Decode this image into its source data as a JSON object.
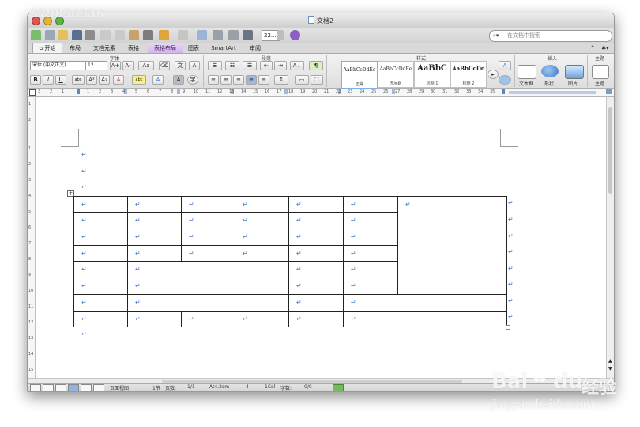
{
  "window": {
    "title": "文档2"
  },
  "toolbar": {
    "zoom": "22..."
  },
  "search": {
    "placeholder": "在文档中搜索"
  },
  "tabs": [
    {
      "label": "开始"
    },
    {
      "label": "布局"
    },
    {
      "label": "文档元素"
    },
    {
      "label": "表格"
    },
    {
      "label": "表格布局"
    },
    {
      "label": "图表"
    },
    {
      "label": "SmartArt"
    },
    {
      "label": "审阅"
    }
  ],
  "ribbon": {
    "font_group_label": "字体",
    "para_group_label": "段落",
    "styles_group_label": "样式",
    "insert_group_label": "插入",
    "theme_group_label": "主题",
    "font_name": "宋体 (中文正文)",
    "font_size": "12",
    "styles": [
      {
        "sample": "AaBbCcDdEe",
        "name": "正常"
      },
      {
        "sample": "AaBbCcDdEe",
        "name": "无间距"
      },
      {
        "sample": "AaBbC",
        "name": "标题 1"
      },
      {
        "sample": "AaBbCcDd",
        "name": "标题 2"
      }
    ],
    "insert": [
      {
        "label": "文本框"
      },
      {
        "label": "形状"
      },
      {
        "label": "图片"
      }
    ],
    "theme_label": "主题"
  },
  "ruler": {
    "marks": [
      "3",
      "2",
      "1",
      "1",
      "2",
      "3",
      "4",
      "5",
      "6",
      "7",
      "8",
      "9",
      "10",
      "11",
      "12",
      "13",
      "14",
      "15",
      "16",
      "17",
      "18",
      "19",
      "20",
      "21",
      "22",
      "23",
      "24",
      "25",
      "26",
      "27",
      "28",
      "29",
      "30",
      "31",
      "32",
      "33",
      "34",
      "35"
    ]
  },
  "vruler": {
    "marks": [
      "1",
      "2",
      "1",
      "2",
      "3",
      "4",
      "5",
      "6",
      "7",
      "8",
      "9",
      "10",
      "11",
      "12",
      "13",
      "14",
      "15"
    ]
  },
  "document": {
    "paragraph_mark": "↵"
  },
  "status": {
    "view": "页面视图",
    "section": "1节",
    "page_label": "页数:",
    "page_value": "1/1",
    "position": "At4.2cm",
    "line": "4",
    "col": "1Col",
    "words_label": "字数:",
    "words_value": "0/0"
  },
  "watermark": {
    "top_left": "579850936",
    "brand_left": "Bai",
    "brand_right": "du",
    "brand_cn": "经验",
    "url": "jingyan.baidu.com"
  }
}
